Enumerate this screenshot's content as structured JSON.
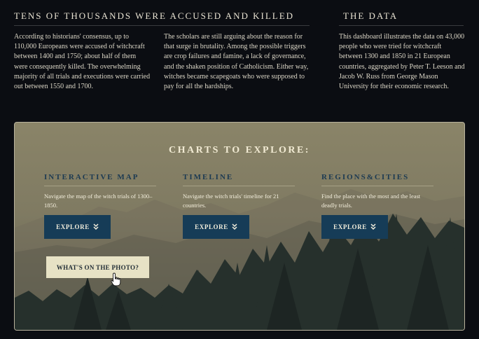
{
  "columns": [
    {
      "heading": "TENS OF THOUSANDS WERE ACCUSED AND KILLED",
      "paragraph": "According to historians' consensus, up to 110,000 Europeans were accused of witchcraft between 1400 and 1750; about half of them were consequently killed. The overwhelming majority of all trials and executions were carried out between 1550 and 1700."
    },
    {
      "heading": "",
      "paragraph": "The scholars are still arguing about the reason for that surge in brutality. Among the possible triggers are crop failures and famine, a lack of governance, and the shaken position of Catholicism. Either way, witches became scapegoats who were supposed to pay for all the hardships."
    },
    {
      "heading": "THE DATA",
      "paragraph": "This dashboard illustrates the data on 43,000 people who were tried for witchcraft between 1300 and 1850 in 21 European countries, aggregated by Peter T. Leeson and Jacob W. Russ from George Mason University for their economic research."
    }
  ],
  "panel": {
    "title": "CHARTS TO EXPLORE:",
    "charts": [
      {
        "title": "INTERACTIVE MAP",
        "description": "Navigate the map of the witch trials of 1300–1850.",
        "button": "EXPLORE"
      },
      {
        "title": "TIMELINE",
        "description": "Navigate the witch trials' timeline for 21 countries.",
        "button": "EXPLORE"
      },
      {
        "title": "REGIONS&CITIES",
        "description": "Find the place with the most and the least deadly trials.",
        "button": "EXPLORE"
      }
    ],
    "photo_button": "WHAT'S ON THE PHOTO?"
  },
  "colors": {
    "page_bg": "#0b0d12",
    "panel_bg": "#857f66",
    "explore_button": "#163c57",
    "photo_button": "#e7e2c5",
    "chart_title": "#1c3a52"
  },
  "icons": {
    "explore": "double-chevron-down-icon",
    "cursor": "hand-pointer-icon"
  }
}
